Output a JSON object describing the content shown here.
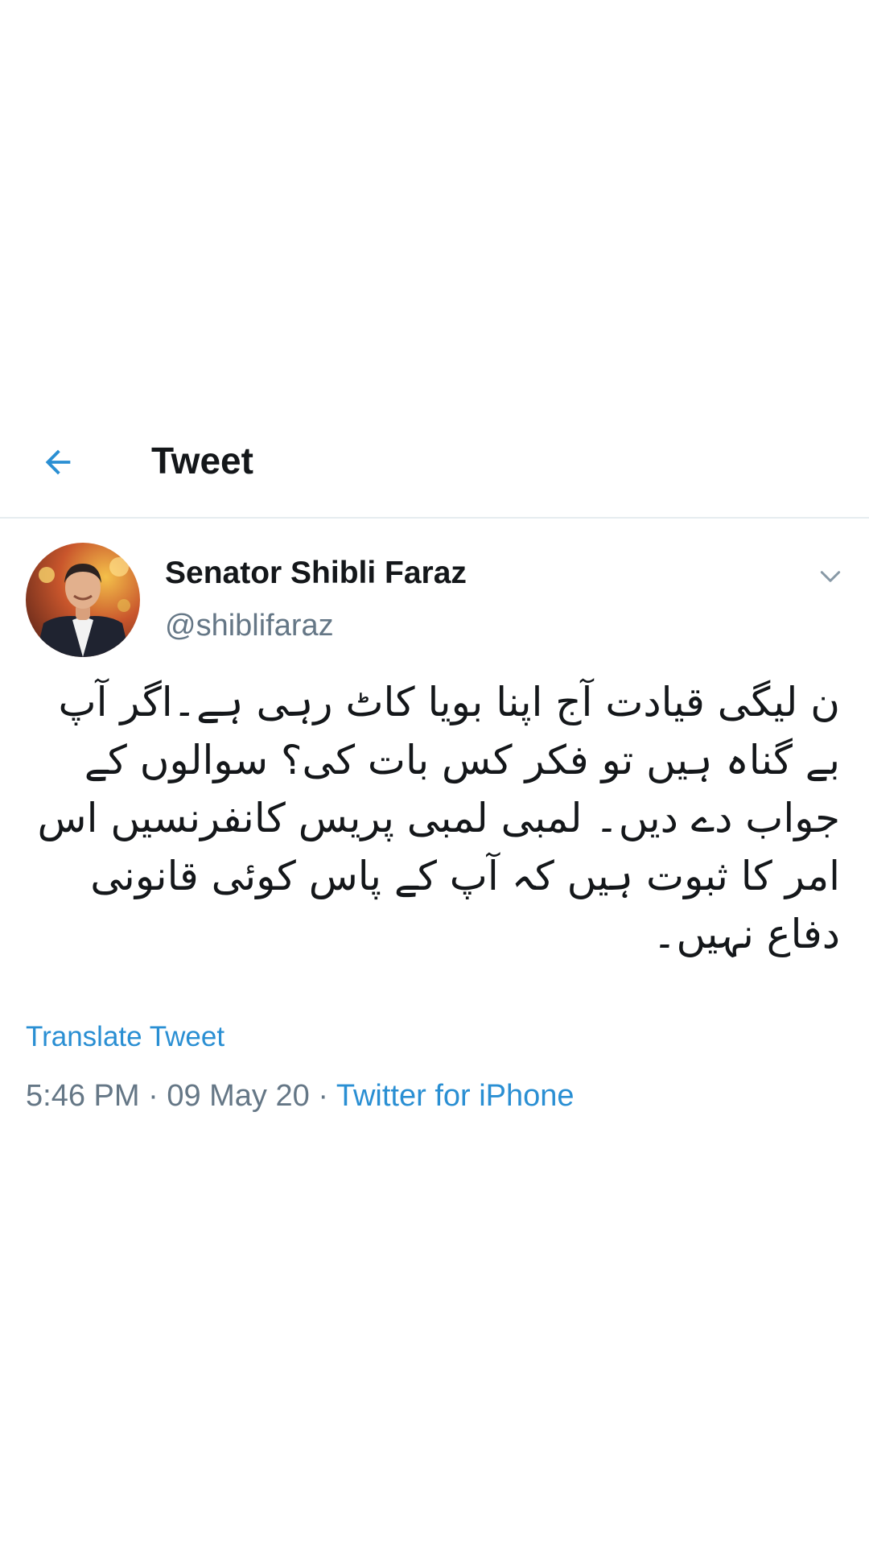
{
  "header": {
    "title": "Tweet",
    "back_icon": "arrow-left-icon"
  },
  "colors": {
    "accent": "#2a8fd3",
    "text_primary": "#14171a",
    "text_secondary": "#657786",
    "divider": "#e6ecf0"
  },
  "tweet": {
    "author_name": "Senator Shibli Faraz",
    "author_handle": "@shiblifaraz",
    "avatar": "avatar-photo",
    "menu_icon": "chevron-down-icon",
    "text": "ن لیگی قیادت آج اپنا بویا کاٹ رہی ہے۔اگر آپ بے گناہ ہیں تو فکر کس بات کی؟ سوالوں کے جواب دے دیں۔ لمبی لمبی پریس کانفرنسیں اس امر کا ثبوت ہیں کہ آپ کے پاس کوئی قانونی دفاع نہیں۔",
    "translate_label": "Translate Tweet",
    "time": "5:46 PM",
    "separator": " · ",
    "date": "09 May 20",
    "source": "Twitter for iPhone"
  }
}
